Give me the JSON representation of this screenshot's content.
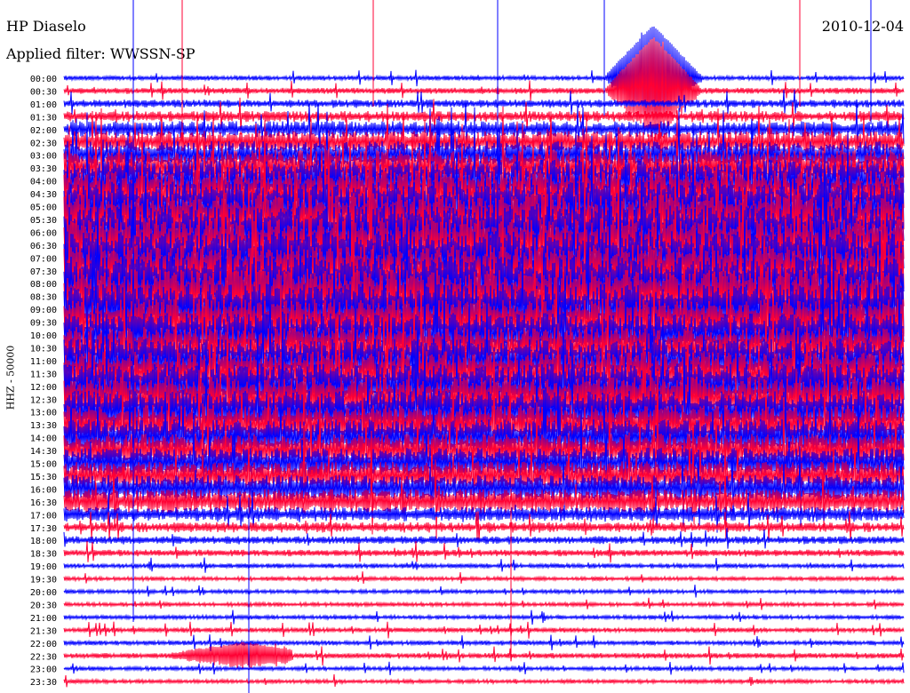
{
  "header": {
    "station": "HP Diaselo",
    "filter_label": "Applied filter: WWSSN-SP",
    "date": "2010-12-04"
  },
  "chart_data": {
    "type": "helicorder",
    "title": "HP Diaselo",
    "subtitle": "Applied filter: WWSSN-SP",
    "date": "2010-12-04",
    "ylabel": "HHZ - 50000",
    "row_labels": [
      "00:00",
      "00:30",
      "01:00",
      "01:30",
      "02:00",
      "02:30",
      "03:00",
      "03:30",
      "04:00",
      "04:30",
      "05:00",
      "05:30",
      "06:00",
      "06:30",
      "07:00",
      "07:30",
      "08:00",
      "08:30",
      "09:00",
      "09:30",
      "10:00",
      "10:30",
      "11:00",
      "11:30",
      "12:00",
      "12:30",
      "13:00",
      "13:30",
      "14:00",
      "14:30",
      "15:00",
      "15:30",
      "16:00",
      "16:30",
      "17:00",
      "17:30",
      "18:00",
      "18:30",
      "19:00",
      "19:30",
      "20:00",
      "20:30",
      "21:00",
      "21:30",
      "22:00",
      "22:30",
      "23:00",
      "23:30"
    ],
    "trace_colors": [
      "#0000ff",
      "#ff0033"
    ],
    "relative_noise_amplitude": [
      0.35,
      0.45,
      0.6,
      0.8,
      1.2,
      1.6,
      2.0,
      2.6,
      3.0,
      3.4,
      3.6,
      3.8,
      3.8,
      3.9,
      3.8,
      3.7,
      3.9,
      3.9,
      3.6,
      3.3,
      3.1,
      3.0,
      3.1,
      3.2,
      3.2,
      3.2,
      3.0,
      2.8,
      2.6,
      2.4,
      2.2,
      2.1,
      2.0,
      1.8,
      1.1,
      0.75,
      0.6,
      0.5,
      0.35,
      0.3,
      0.3,
      0.3,
      0.3,
      0.35,
      0.35,
      0.4,
      0.3,
      0.3
    ]
  }
}
